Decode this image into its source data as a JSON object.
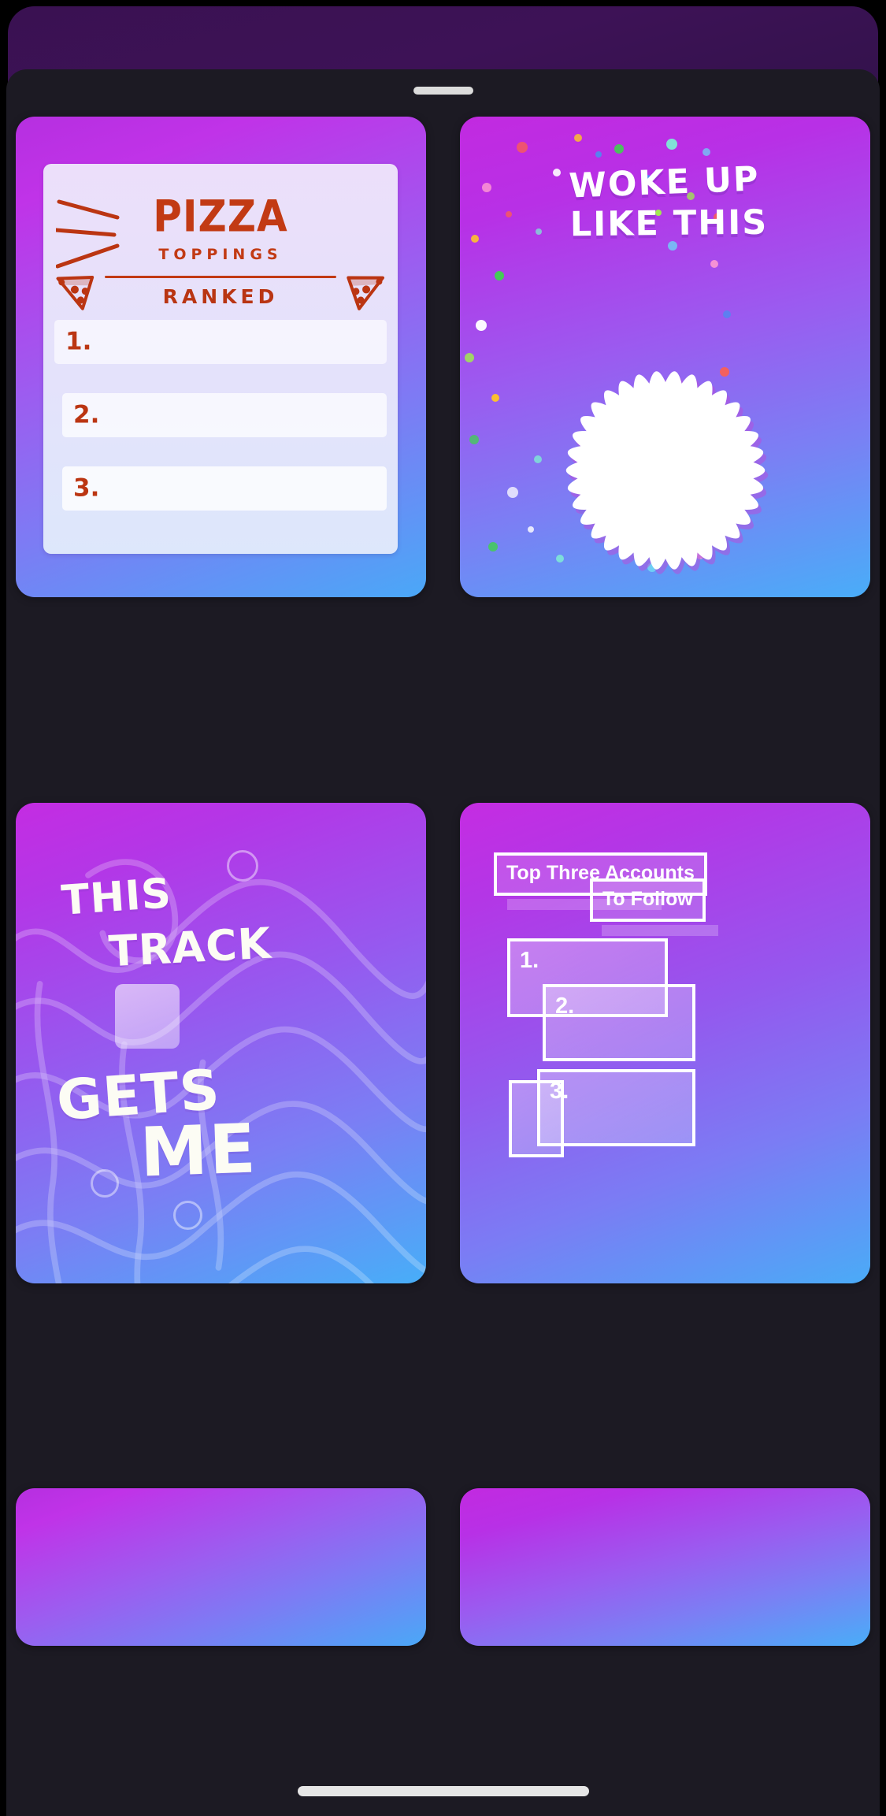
{
  "sheet": {
    "grabber": "drag-handle"
  },
  "templates": [
    {
      "id": "pizza-toppings-ranked",
      "title": "PIZZA",
      "subtitle": "TOPPINGS",
      "ranked_label": "RANKED",
      "items": [
        "1.",
        "2.",
        "3."
      ],
      "colors": {
        "ink": "#c23a14",
        "paper": "#ecdffa"
      }
    },
    {
      "id": "woke-up-like-this",
      "line1": "WOKE UP",
      "line2": "LIKE THIS",
      "shape": "starburst-photo-frame",
      "confetti_colors": [
        "#ff5f4d",
        "#ffc328",
        "#3fd14f",
        "#7fe8d6",
        "#6fd0f5",
        "#ff9ad2",
        "#ffffff",
        "#4a8cf0",
        "#a0f04a"
      ]
    },
    {
      "id": "this-track-gets-me",
      "line1": "THIS",
      "line2": "TRACK",
      "line3": "GETS",
      "line4": "ME",
      "thumb": "album-art-placeholder"
    },
    {
      "id": "top-three-accounts-to-follow",
      "heading1": "Top Three Accounts",
      "heading2": "To Follow",
      "items": [
        "1.",
        "2.",
        "3."
      ]
    }
  ],
  "partial_row": [
    {
      "id": "partial-template-left"
    },
    {
      "id": "partial-template-right"
    }
  ],
  "theme": {
    "sheet_bg": "#1c1a23",
    "backdrop": "#3a1152",
    "accent_magenta": "#c22ae0",
    "accent_blue": "#4aa8f7"
  }
}
